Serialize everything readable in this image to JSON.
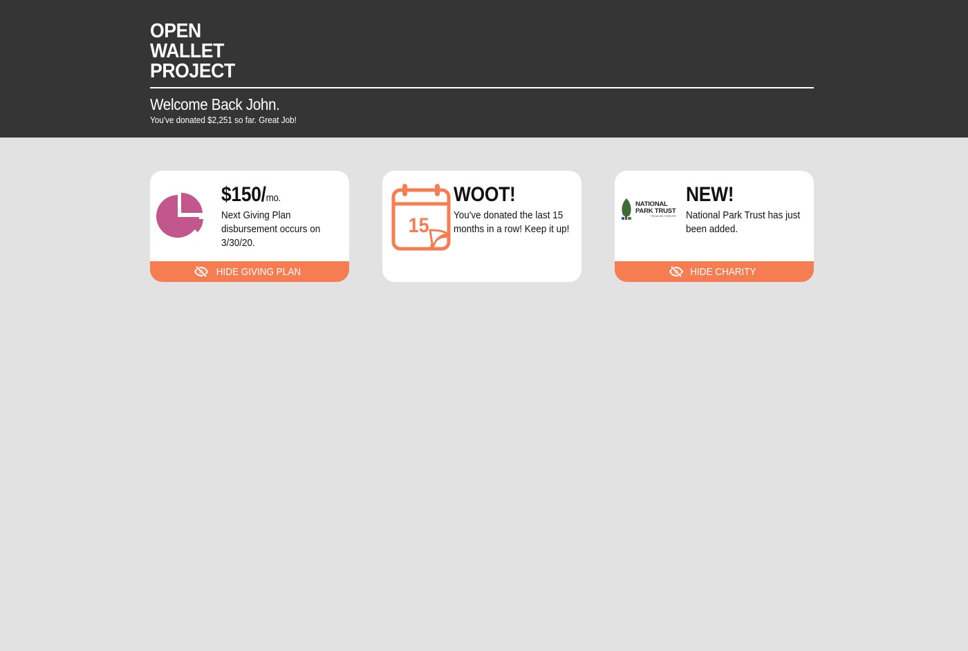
{
  "header": {
    "logo_lines": [
      "OPEN",
      "WALLET",
      "PROJECT"
    ],
    "welcome": "Welcome Back John.",
    "donated_summary": "You've donated $2,251 so far. Great Job!"
  },
  "colors": {
    "header_bg": "#353535",
    "page_bg": "#e2e2e2",
    "accent": "#f67c51",
    "pie_color": "#c2578e"
  },
  "cards": {
    "giving_plan": {
      "icon": "pie-chart-icon",
      "amount": "$150/",
      "unit": "mo.",
      "text": "Next Giving Plan disbursement occurs on 3/30/20.",
      "action_icon": "eye-slash-icon",
      "action_label": "HIDE GIVING PLAN"
    },
    "streak": {
      "icon": "calendar-icon",
      "calendar_number": "15",
      "title": "WOOT!",
      "text": "You've donated the last 15 months in a row! Keep it up!"
    },
    "new_charity": {
      "logo_line1": "NATIONAL",
      "logo_line2": "PARK TRUST",
      "logo_tagline": "TREASURE FOREVER",
      "title": "NEW!",
      "text": "National Park Trust has just been added.",
      "action_icon": "eye-slash-icon",
      "action_label": "HIDE CHARITY"
    }
  }
}
